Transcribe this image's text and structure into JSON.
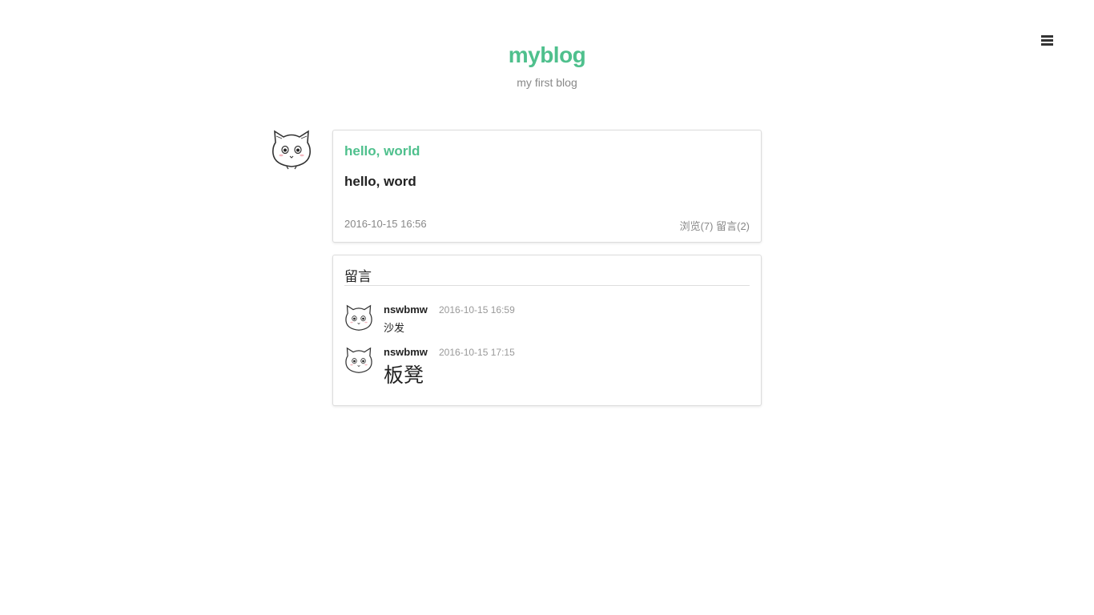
{
  "header": {
    "title": "myblog",
    "subtitle": "my first blog",
    "menu_icon": "hamburger-menu-icon"
  },
  "post": {
    "author_avatar": "cat-face-icon",
    "title": "hello, world",
    "content": "hello, word",
    "date": "2016-10-15 16:56",
    "views_label": "浏览(7)",
    "comments_label": "留言(2)"
  },
  "comments": {
    "heading": "留言",
    "items": [
      {
        "author": "nswbmw",
        "time": "2016-10-15 16:59",
        "text": "沙发",
        "avatar": "cat-face-icon"
      },
      {
        "author": "nswbmw",
        "time": "2016-10-15 17:15",
        "text": "板凳",
        "avatar": "cat-face-icon"
      }
    ]
  },
  "colors": {
    "accent": "#4fc08d",
    "muted": "#888888",
    "text": "#222222",
    "border": "#dddddd"
  }
}
